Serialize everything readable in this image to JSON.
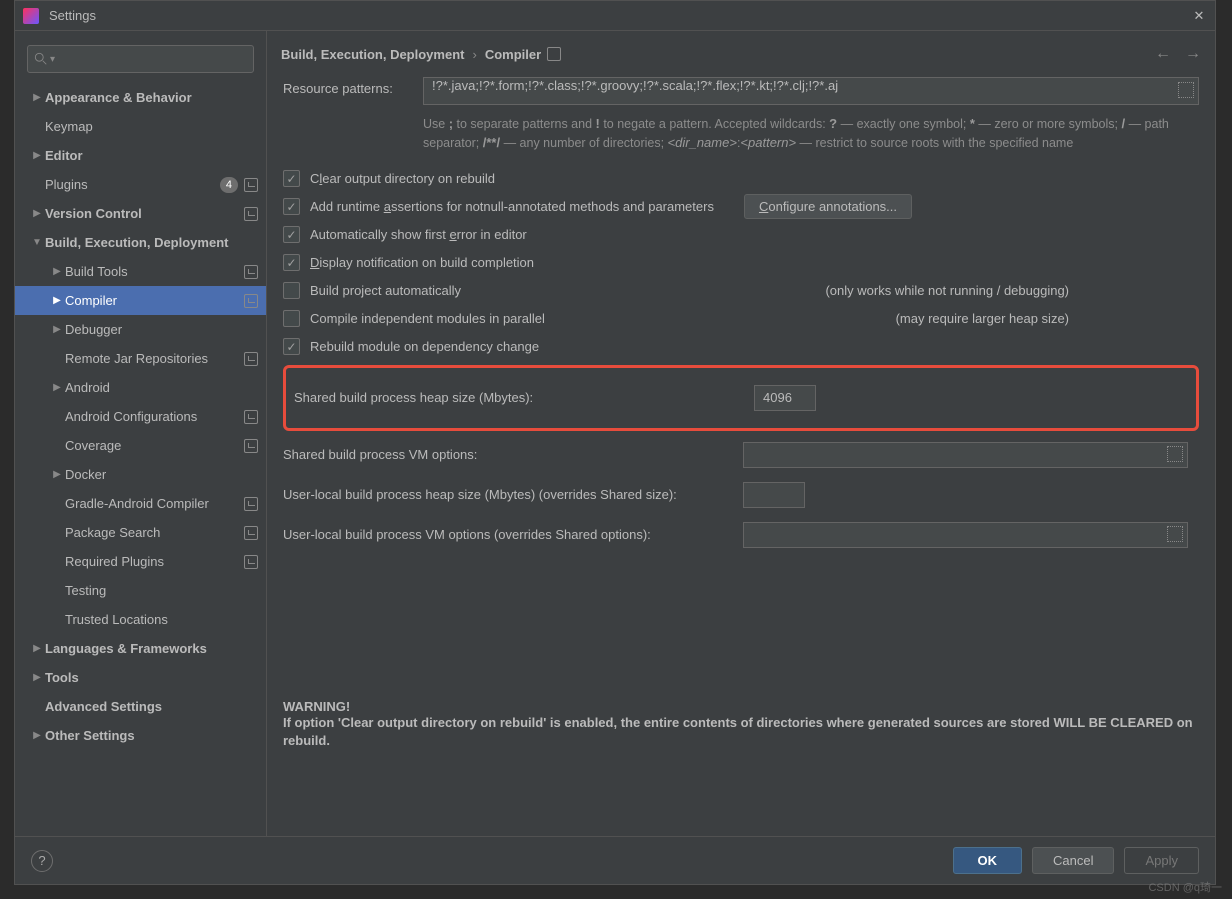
{
  "window": {
    "title": "Settings"
  },
  "search": {
    "placeholder": ""
  },
  "breadcrumb": {
    "parent": "Build, Execution, Deployment",
    "current": "Compiler"
  },
  "sidebar": {
    "items": [
      {
        "label": "Appearance & Behavior",
        "depth": 0,
        "bold": true,
        "arrow": ">"
      },
      {
        "label": "Keymap",
        "depth": 0
      },
      {
        "label": "Editor",
        "depth": 0,
        "bold": true,
        "arrow": ">"
      },
      {
        "label": "Plugins",
        "depth": 0,
        "badge": "4",
        "proj": true
      },
      {
        "label": "Version Control",
        "depth": 0,
        "bold": true,
        "arrow": ">",
        "proj": true
      },
      {
        "label": "Build, Execution, Deployment",
        "depth": 0,
        "bold": true,
        "arrow": "v"
      },
      {
        "label": "Build Tools",
        "depth": 1,
        "arrow": ">",
        "proj": true
      },
      {
        "label": "Compiler",
        "depth": 1,
        "arrow": ">",
        "selected": true,
        "proj": true
      },
      {
        "label": "Debugger",
        "depth": 1,
        "arrow": ">"
      },
      {
        "label": "Remote Jar Repositories",
        "depth": 1,
        "proj": true
      },
      {
        "label": "Android",
        "depth": 1,
        "arrow": ">"
      },
      {
        "label": "Android Configurations",
        "depth": 1,
        "proj": true
      },
      {
        "label": "Coverage",
        "depth": 1,
        "proj": true
      },
      {
        "label": "Docker",
        "depth": 1,
        "arrow": ">"
      },
      {
        "label": "Gradle-Android Compiler",
        "depth": 1,
        "proj": true
      },
      {
        "label": "Package Search",
        "depth": 1,
        "proj": true
      },
      {
        "label": "Required Plugins",
        "depth": 1,
        "proj": true
      },
      {
        "label": "Testing",
        "depth": 1
      },
      {
        "label": "Trusted Locations",
        "depth": 1
      },
      {
        "label": "Languages & Frameworks",
        "depth": 0,
        "bold": true,
        "arrow": ">"
      },
      {
        "label": "Tools",
        "depth": 0,
        "bold": true,
        "arrow": ">"
      },
      {
        "label": "Advanced Settings",
        "depth": 0,
        "bold": true
      },
      {
        "label": "Other Settings",
        "depth": 0,
        "bold": true,
        "arrow": ">"
      }
    ]
  },
  "form": {
    "resource_label": "Resource patterns:",
    "resource_value": "!?*.java;!?*.form;!?*.class;!?*.groovy;!?*.scala;!?*.flex;!?*.kt;!?*.clj;!?*.aj",
    "hint_html": "Use <b>;</b> to separate patterns and <b>!</b> to negate a pattern. Accepted wildcards: <b>?</b> — exactly one symbol; <b>*</b> — zero or more symbols; <b>/</b> — path separator; <b>/**/</b> — any number of directories; <i>&lt;dir_name&gt;</i>:<i>&lt;pattern&gt;</i> — restrict to source roots with the specified name",
    "checks": [
      {
        "label": "Clear output directory on rebuild",
        "checked": true,
        "u": [
          1,
          2
        ]
      },
      {
        "label": "Add runtime assertions for notnull-annotated methods and parameters",
        "checked": true,
        "u": [
          12,
          13
        ],
        "button": "Configure annotations..."
      },
      {
        "label": "Automatically show first error in editor",
        "checked": true,
        "u": [
          25,
          26
        ]
      },
      {
        "label": "Display notification on build completion",
        "checked": true,
        "u": [
          0,
          1
        ]
      },
      {
        "label": "Build project automatically",
        "checked": false,
        "note": "(only works while not running / debugging)"
      },
      {
        "label": "Compile independent modules in parallel",
        "checked": false,
        "note": "(may require larger heap size)"
      },
      {
        "label": "Rebuild module on dependency change",
        "checked": true
      }
    ],
    "heap_label": "Shared build process heap size (Mbytes):",
    "heap_value": "4096",
    "vm_label": "Shared build process VM options:",
    "user_heap_label": "User-local build process heap size (Mbytes) (overrides Shared size):",
    "user_heap_value": "",
    "user_vm_label": "User-local build process VM options (overrides Shared options):",
    "warning_title": "WARNING!",
    "warning_body": "If option 'Clear output directory on rebuild' is enabled, the entire contents of directories where generated sources are stored WILL BE CLEARED on rebuild."
  },
  "footer": {
    "ok": "OK",
    "cancel": "Cancel",
    "apply": "Apply"
  },
  "watermark": "CSDN @q琦一"
}
